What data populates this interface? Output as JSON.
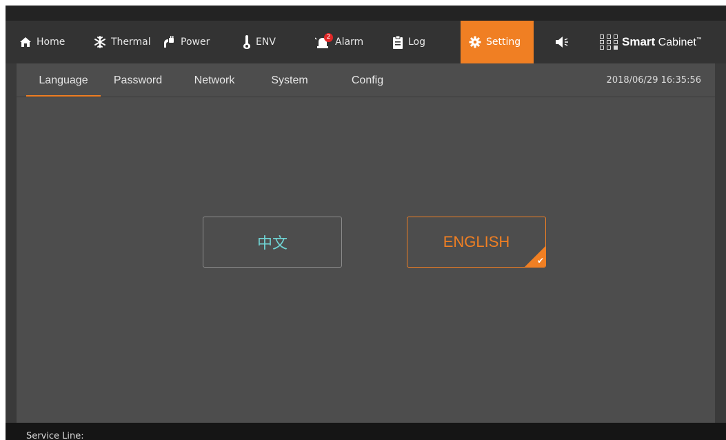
{
  "nav": {
    "items": [
      {
        "label": "Home",
        "icon": "home-icon"
      },
      {
        "label": "Thermal",
        "icon": "snowflake-icon"
      },
      {
        "label": "Power",
        "icon": "plug-icon"
      },
      {
        "label": "ENV",
        "icon": "thermometer-icon"
      },
      {
        "label": "Alarm",
        "icon": "alarm-icon",
        "badge": "2"
      },
      {
        "label": "Log",
        "icon": "clipboard-icon"
      },
      {
        "label": "Setting",
        "icon": "gear-icon",
        "active": true
      }
    ],
    "mute_icon": "speaker-mute-icon",
    "brand": {
      "bold": "Smart",
      "rest": "Cabinet",
      "mark": "™"
    }
  },
  "tabs": {
    "items": [
      {
        "label": "Language",
        "active": true
      },
      {
        "label": "Password"
      },
      {
        "label": "Network"
      },
      {
        "label": "System"
      },
      {
        "label": "Config"
      }
    ],
    "datetime": "2018/06/29 16:35:56"
  },
  "language": {
    "options": [
      {
        "label": "中文",
        "selected": false
      },
      {
        "label": "ENGLISH",
        "selected": true
      }
    ],
    "check_icon": "checkmark-icon"
  },
  "footer": {
    "service_line": "Service Line:"
  },
  "colors": {
    "accent": "#f07f23",
    "nav_bg": "#333333",
    "panel_bg": "#4d4d4d",
    "zh_text": "#6fd3d3",
    "badge": "#e02727"
  }
}
